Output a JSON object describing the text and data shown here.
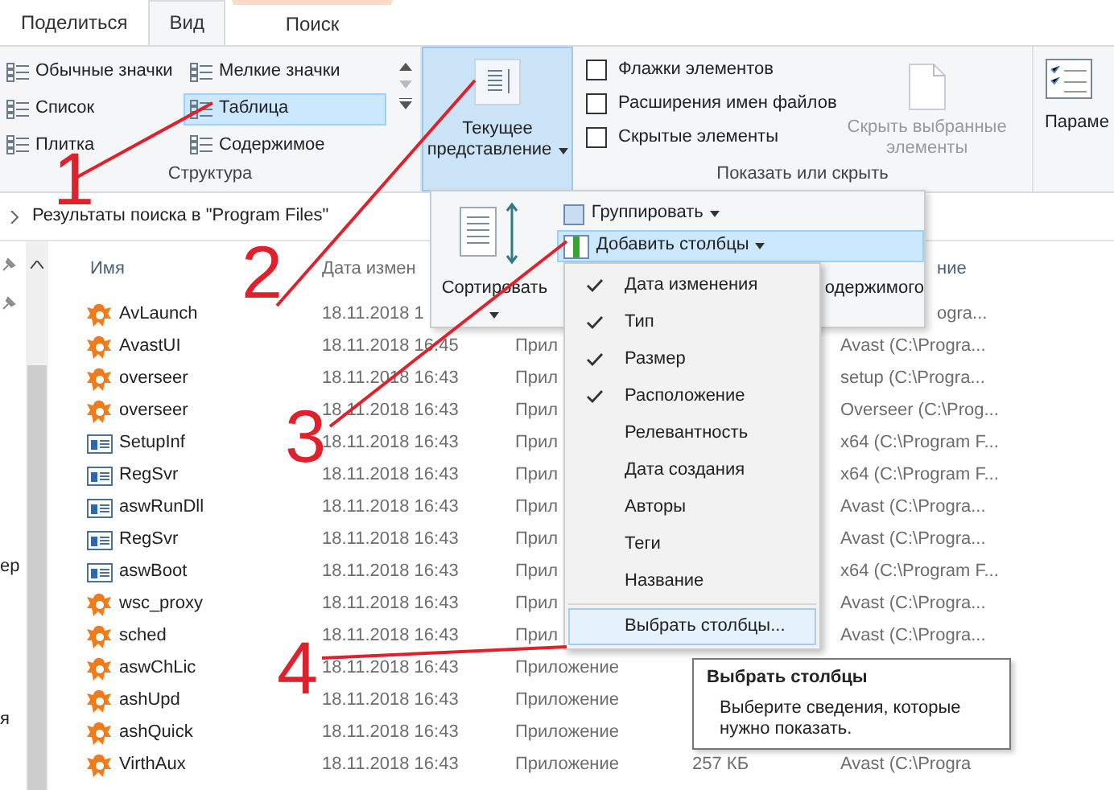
{
  "ribbon_tabs": [
    {
      "label": "Поделиться",
      "selected": false,
      "kind": "normal"
    },
    {
      "label": "Вид",
      "selected": true,
      "kind": "normal"
    },
    {
      "label": "Поиск",
      "selected": false,
      "kind": "contextual"
    }
  ],
  "layout_group": {
    "label": "Структура",
    "options": [
      {
        "label": "Обычные значки",
        "selected": false
      },
      {
        "label": "Мелкие значки",
        "selected": false
      },
      {
        "label": "Список",
        "selected": false
      },
      {
        "label": "Таблица",
        "selected": true
      },
      {
        "label": "Плитка",
        "selected": false
      },
      {
        "label": "Содержимое",
        "selected": false
      }
    ]
  },
  "current_view": {
    "label_1": "Текущее",
    "label_2": "представление",
    "pressed": true
  },
  "show_hide": {
    "label": "Показать или скрыть",
    "checkboxes": [
      {
        "label": "Флажки элементов",
        "checked": false
      },
      {
        "label": "Расширения имен файлов",
        "checked": false
      },
      {
        "label": "Скрытые элементы",
        "checked": false
      }
    ],
    "hide_selected": {
      "label_1": "Скрыть выбранные",
      "label_2": "элементы",
      "disabled": true
    }
  },
  "options_button": {
    "label": "Параме"
  },
  "address": {
    "path": "Результаты поиска в \"Program Files\""
  },
  "nav_pane": {
    "texts": [
      "ер",
      "я"
    ]
  },
  "columns": [
    "Имя",
    "Дата измен",
    "ние"
  ],
  "rows": [
    {
      "kind": "avast",
      "name": "AvLaunch",
      "date": "18.11.2018 1",
      "type": "",
      "location": "ogra..."
    },
    {
      "kind": "avast",
      "name": "AvastUI",
      "date": "18.11.2018 16:45",
      "type": "Прил",
      "location": "Avast (C:\\Progra..."
    },
    {
      "kind": "avast",
      "name": "overseer",
      "date": "18.11.2018 16:43",
      "type": "Прил",
      "location": "setup (C:\\Progra..."
    },
    {
      "kind": "avast",
      "name": "overseer",
      "date": "18.11.2018 16:43",
      "type": "Прил",
      "location": "Overseer (C:\\Prog..."
    },
    {
      "kind": "app",
      "name": "SetupInf",
      "date": "18.11.2018 16:43",
      "type": "Прил",
      "location": "x64 (C:\\Program F..."
    },
    {
      "kind": "app",
      "name": "RegSvr",
      "date": "18.11.2018 16:43",
      "type": "Прил",
      "location": "x64 (C:\\Program F..."
    },
    {
      "kind": "app",
      "name": "aswRunDll",
      "date": "18.11.2018 16:43",
      "type": "Прил",
      "location": "Avast (C:\\Progra..."
    },
    {
      "kind": "app",
      "name": "RegSvr",
      "date": "18.11.2018 16:43",
      "type": "Прил",
      "location": "Avast (C:\\Progra..."
    },
    {
      "kind": "app",
      "name": "aswBoot",
      "date": "18.11.2018 16:43",
      "type": "Прил",
      "location": "x64 (C:\\Program F..."
    },
    {
      "kind": "avast",
      "name": "wsc_proxy",
      "date": "18.11.2018 16:43",
      "type": "Прил",
      "location": "Avast (C:\\Progra..."
    },
    {
      "kind": "avast",
      "name": "sched",
      "date": "18.11.2018 16:43",
      "type": "Прил",
      "location": "Avast (C:\\Progra..."
    },
    {
      "kind": "avast",
      "name": "aswChLic",
      "date": "18.11.2018 16:43",
      "type": "Приложение",
      "location": ""
    },
    {
      "kind": "avast",
      "name": "ashUpd",
      "date": "18.11.2018 16:43",
      "type": "Приложение",
      "location": ""
    },
    {
      "kind": "avast",
      "name": "ashQuick",
      "date": "18.11.2018 16:43",
      "type": "Приложение",
      "location": ""
    },
    {
      "kind": "avast",
      "name": "VirthAux",
      "date": "18.11.2018 16:43",
      "type": "Приложение",
      "size": "257 КБ",
      "location": "Avast (C:\\Progra"
    }
  ],
  "view_dropdown": {
    "sort": "Сортировать",
    "group": "Группировать",
    "add_columns": {
      "label": "Добавить столбцы",
      "selected": true
    },
    "fit_text": "одержимого"
  },
  "columns_menu": {
    "items": [
      {
        "label": "Дата изменения",
        "checked": true
      },
      {
        "label": "Тип",
        "checked": true
      },
      {
        "label": "Размер",
        "checked": true
      },
      {
        "label": "Расположение",
        "checked": true
      },
      {
        "label": "Релевантность",
        "checked": false
      },
      {
        "label": "Дата создания",
        "checked": false
      },
      {
        "label": "Авторы",
        "checked": false
      },
      {
        "label": "Теги",
        "checked": false
      },
      {
        "label": "Название",
        "checked": false
      }
    ],
    "choose": {
      "label": "Выбрать столбцы...",
      "selected": true
    }
  },
  "tooltip": {
    "title": "Выбрать столбцы",
    "text": "Выберите сведения, которые нужно показать."
  },
  "annotations": [
    {
      "number": "1"
    },
    {
      "number": "2"
    },
    {
      "number": "3"
    },
    {
      "number": "4"
    }
  ]
}
